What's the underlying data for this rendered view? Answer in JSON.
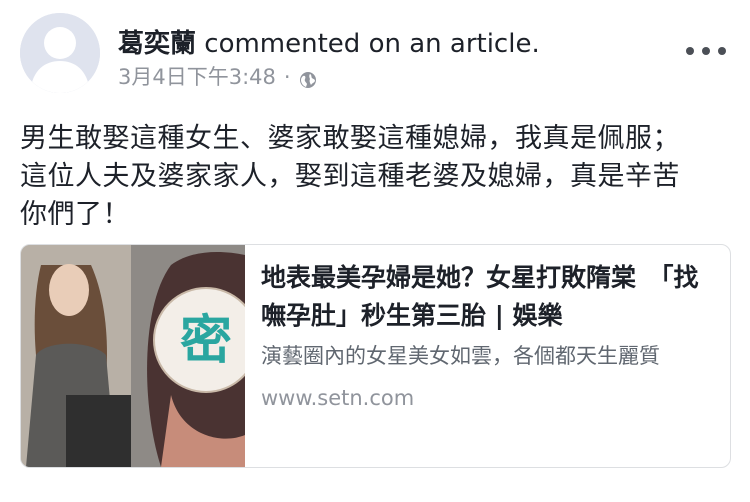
{
  "post": {
    "author": "葛奕蘭",
    "action": " commented on an article.",
    "timestamp": "3月4日下午3:48",
    "separator": "·",
    "privacy_icon": "globe-icon",
    "body": "男生敢娶這種女生、婆家敢娶這種媳婦，我真是佩服；\n這位人夫及婆家家人，娶到這種老婆及媳婦，真是辛苦\n你們了！"
  },
  "link": {
    "title": "地表最美孕婦是她？女星打敗隋棠　「找嘸孕肚」秒生第三胎 | 娛樂",
    "description": "演藝圈內的女星美女如雲，各個都天生麗質",
    "domain": "www.setn.com",
    "thumb_stamp_text": "密"
  },
  "colors": {
    "text": "#1d2129",
    "meta": "#90949c",
    "border": "#dddfe2",
    "avatar_bg": "#dfe3ee"
  }
}
